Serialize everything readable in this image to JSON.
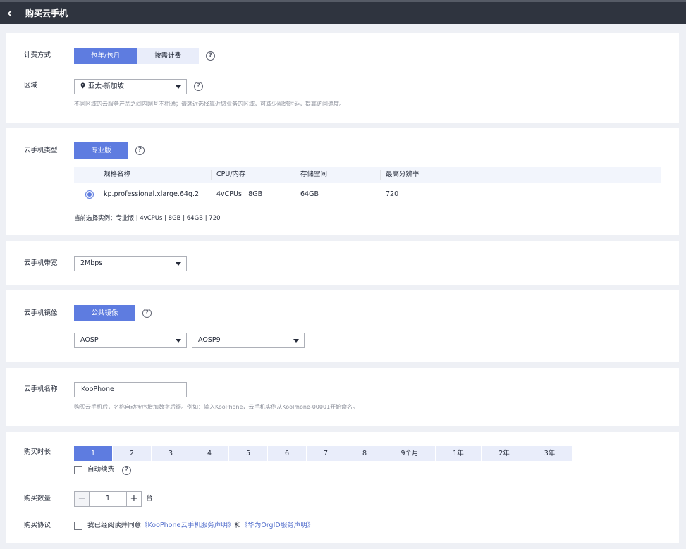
{
  "header": {
    "title": "购买云手机"
  },
  "billing": {
    "label": "计费方式",
    "options": [
      "包年/包月",
      "按需计费"
    ],
    "selected": "包年/包月"
  },
  "region": {
    "label": "区域",
    "value": "亚太-新加坡",
    "hint": "不同区域的云服务产品之间内网互不相通；请就近选择靠近您业务的区域，可减少网络时延，提高访问速度。"
  },
  "phone_type": {
    "label": "云手机类型",
    "button": "专业版",
    "columns": [
      "规格名称",
      "CPU/内存",
      "存储空间",
      "最高分辨率"
    ],
    "rows": [
      {
        "name": "kp.professional.xlarge.64g.2",
        "cpu": "4vCPUs | 8GB",
        "storage": "64GB",
        "resolution": "720"
      }
    ],
    "current": "当前选择实例：专业版 | 4vCPUs | 8GB | 64GB | 720"
  },
  "bandwidth": {
    "label": "云手机带宽",
    "value": "2Mbps"
  },
  "image": {
    "label": "云手机镜像",
    "button": "公共镜像",
    "os": "AOSP",
    "version": "AOSP9"
  },
  "name": {
    "label": "云手机名称",
    "value": "KooPhone",
    "hint": "购买云手机后，名称自动按序增加数字后缀。例如：输入KooPhone，云手机实例从KooPhone-00001开始命名。"
  },
  "duration": {
    "label": "购买时长",
    "options": [
      "1",
      "2",
      "3",
      "4",
      "5",
      "6",
      "7",
      "8",
      "9个月",
      "1年",
      "2年",
      "3年"
    ],
    "selected": "1",
    "auto_renew": "自动续费"
  },
  "quantity": {
    "label": "购买数量",
    "value": "1",
    "unit": "台"
  },
  "agreement": {
    "label": "购买协议",
    "prefix": "我已经阅读并同意",
    "link1": "《KooPhone云手机服务声明》",
    "middle": "和",
    "link2": "《华为OrgID服务声明》"
  },
  "colors": {
    "primary": "#5e7ce0",
    "header_bg": "#2f343f",
    "page_bg": "#eef0f5"
  }
}
